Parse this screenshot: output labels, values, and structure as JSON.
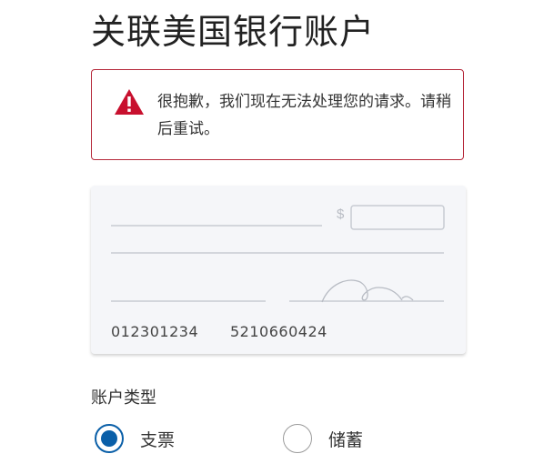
{
  "page": {
    "title": "关联美国银行账户"
  },
  "alert": {
    "message": "很抱歉，我们现在无法处理您的请求。请稍后重试。",
    "icon": "warning-icon",
    "border_color": "#b5283a",
    "icon_color": "#c8102e"
  },
  "check": {
    "currency_symbol": "$",
    "routing_number": "012301234",
    "account_number": "5210660424"
  },
  "account_type": {
    "label": "账户类型",
    "options": [
      {
        "label": "支票",
        "selected": true
      },
      {
        "label": "储蓄",
        "selected": false
      }
    ],
    "accent_color": "#0a5fa8"
  }
}
